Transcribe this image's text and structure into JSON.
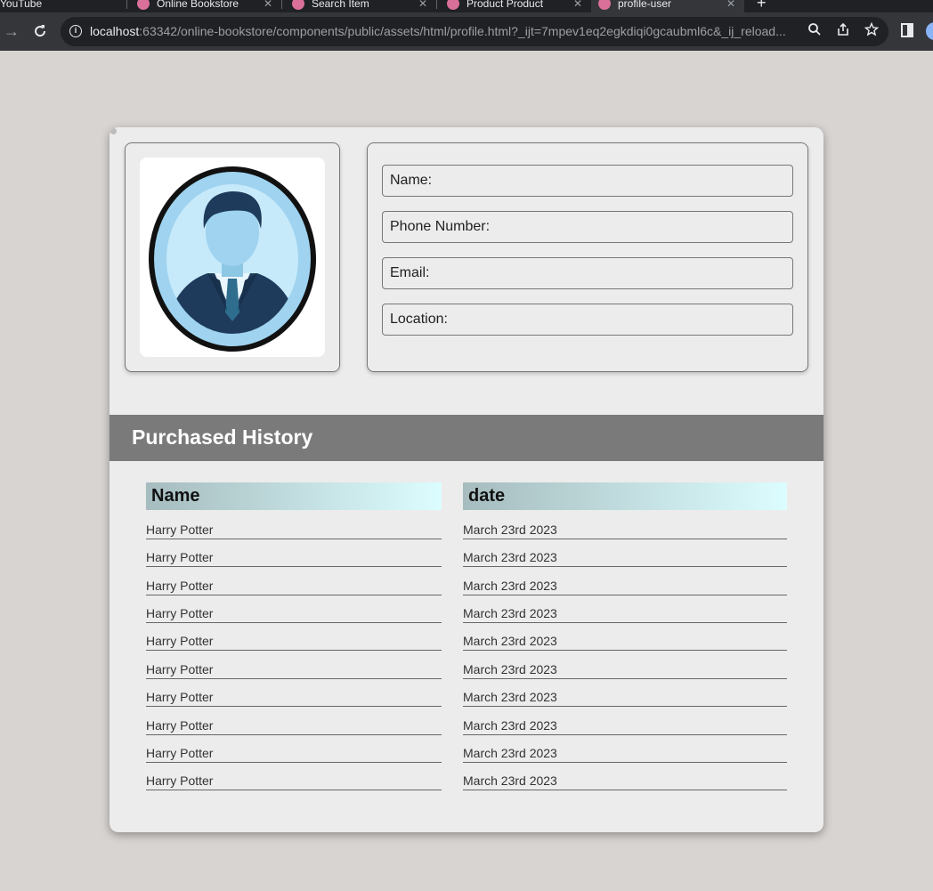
{
  "browser": {
    "tabs": [
      {
        "label": "YouTube"
      },
      {
        "label": "Online Bookstore"
      },
      {
        "label": "Search Item"
      },
      {
        "label": "Product Product"
      },
      {
        "label": "profile-user"
      }
    ],
    "url_host": "localhost",
    "url_rest": ":63342/online-bookstore/components/public/assets/html/profile.html?_ijt=7mpev1eq2egkdiqi0gcaubml6c&_ij_reload..."
  },
  "profile": {
    "fields": [
      "Name:",
      "Phone Number:",
      "Email:",
      "Location:"
    ]
  },
  "history": {
    "title": "Purchased History",
    "col_name": "Name",
    "col_date": "date",
    "rows": [
      {
        "name": "Harry Potter",
        "date": "March 23rd 2023"
      },
      {
        "name": "Harry Potter",
        "date": "March 23rd 2023"
      },
      {
        "name": "Harry Potter",
        "date": "March 23rd 2023"
      },
      {
        "name": "Harry Potter",
        "date": "March 23rd 2023"
      },
      {
        "name": "Harry Potter",
        "date": "March 23rd 2023"
      },
      {
        "name": "Harry Potter",
        "date": "March 23rd 2023"
      },
      {
        "name": "Harry Potter",
        "date": "March 23rd 2023"
      },
      {
        "name": "Harry Potter",
        "date": "March 23rd 2023"
      },
      {
        "name": "Harry Potter",
        "date": "March 23rd 2023"
      },
      {
        "name": "Harry Potter",
        "date": "March 23rd 2023"
      }
    ]
  },
  "icons": {
    "back": "back-arrow-icon",
    "reload": "reload-icon",
    "info": "site-info-icon",
    "zoom": "zoom-icon",
    "share": "share-icon",
    "bookmark": "star-icon",
    "sidepanel": "side-panel-icon",
    "avatar": "user-avatar-icon"
  },
  "colors": {
    "page_bg": "#d8d4d2",
    "card_bg": "#ececec",
    "history_bar": "#7a7a7a",
    "header_gradient_start": "#a6bcbe",
    "header_gradient_end": "#dcfdff"
  }
}
